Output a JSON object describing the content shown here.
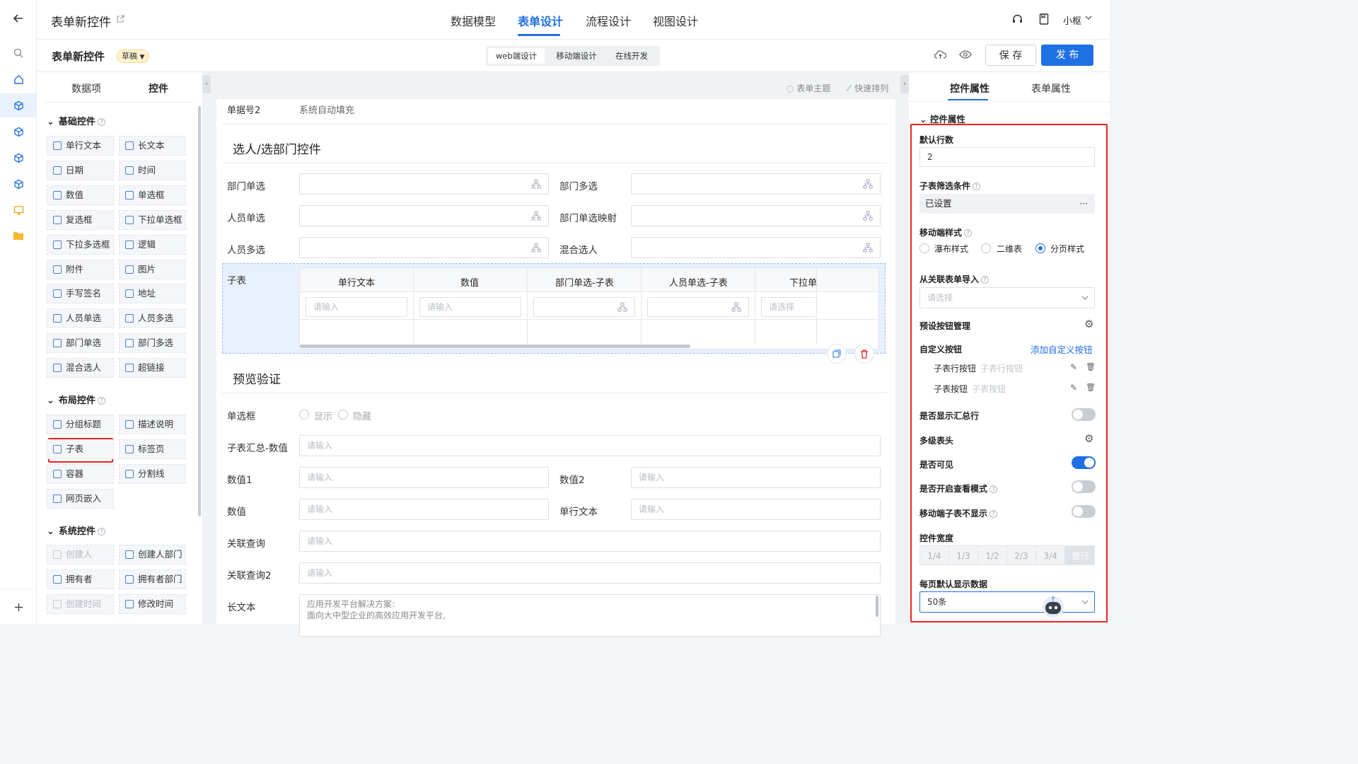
{
  "header": {
    "app_title": "表单新控件",
    "nav": [
      "数据模型",
      "表单设计",
      "流程设计",
      "视图设计"
    ],
    "user": "小枢"
  },
  "subheader": {
    "form_name": "表单新控件",
    "status": "草稿",
    "modes": [
      "web端设计",
      "移动端设计",
      "在线开发"
    ],
    "save": "保 存",
    "publish": "发 布"
  },
  "left_panel": {
    "tabs": [
      "数据项",
      "控件"
    ],
    "basic_title": "基础控件",
    "basic": [
      "单行文本",
      "长文本",
      "日期",
      "时间",
      "数值",
      "单选框",
      "复选框",
      "下拉单选框",
      "下拉多选框",
      "逻辑",
      "附件",
      "图片",
      "手写签名",
      "地址",
      "人员单选",
      "人员多选",
      "部门单选",
      "部门多选",
      "混合选人",
      "超链接"
    ],
    "layout_title": "布局控件",
    "layout": [
      "分组标题",
      "描述说明",
      "子表",
      "标签页",
      "容器",
      "分割线",
      "网页嵌入"
    ],
    "system_title": "系统控件",
    "system": [
      "创建人",
      "创建人部门",
      "拥有者",
      "拥有者部门",
      "创建时间",
      "修改时间"
    ]
  },
  "canvas": {
    "toolbar": [
      "表单主题",
      "快速排列"
    ],
    "serial_label": "单据号2",
    "serial_value": "系统自动填充",
    "section1": "选人/选部门控件",
    "fields1": [
      "部门单选",
      "部门多选",
      "人员单选",
      "部门单选映射",
      "人员多选",
      "混合选人"
    ],
    "subtable_label": "子表",
    "subtable_cols": [
      "单行文本",
      "数值",
      "部门单选-子表",
      "人员单选-子表",
      "下拉单"
    ],
    "subtable_ph": [
      "请输入",
      "请输入",
      "请选择"
    ],
    "section2": "预览验证",
    "radio_label": "单选框",
    "radio_opts": [
      "显示",
      "隐藏"
    ],
    "fields2": [
      "子表汇总-数值",
      "数值1",
      "数值2",
      "数值",
      "单行文本",
      "关联查询",
      "关联查询2"
    ],
    "placeholder": "请输入",
    "longtext_label": "长文本",
    "longtext_lines": [
      "应用开发平台解决方案:",
      "面向大中型企业的高效应用开发平台,"
    ]
  },
  "right_panel": {
    "tabs": [
      "控件属性",
      "表单属性"
    ],
    "section": "控件属性",
    "default_rows_label": "默认行数",
    "default_rows": "2",
    "filter_label": "子表筛选条件",
    "filter_value": "已设置",
    "mobile_label": "移动端样式",
    "mobile_opts": [
      "瀑布样式",
      "二维表",
      "分页样式"
    ],
    "import_label": "从关联表单导入",
    "import_ph": "请选择",
    "preset_label": "预设按钮管理",
    "custom_label": "自定义按钮",
    "add_custom": "添加自定义按钮",
    "custom_buttons": [
      {
        "name": "子表行按钮",
        "hint": "子表行按钮"
      },
      {
        "name": "子表按钮",
        "hint": "子表按钮"
      }
    ],
    "summary_label": "是否显示汇总行",
    "multi_header_label": "多级表头",
    "visible_label": "是否可见",
    "view_mode_label": "是否开启查看模式",
    "mobile_hide_label": "移动端子表不显示",
    "width_label": "控件宽度",
    "widths": [
      "1/4",
      "1/3",
      "1/2",
      "2/3",
      "3/4",
      "整行"
    ],
    "page_size_label": "每页默认显示数据",
    "page_size": "50条",
    "toggles": {
      "summary": false,
      "visible": true,
      "view_mode": false,
      "mobile_hide": false
    }
  },
  "colors": {
    "accent": "#1f6fe5",
    "highlight": "#e8251f"
  }
}
